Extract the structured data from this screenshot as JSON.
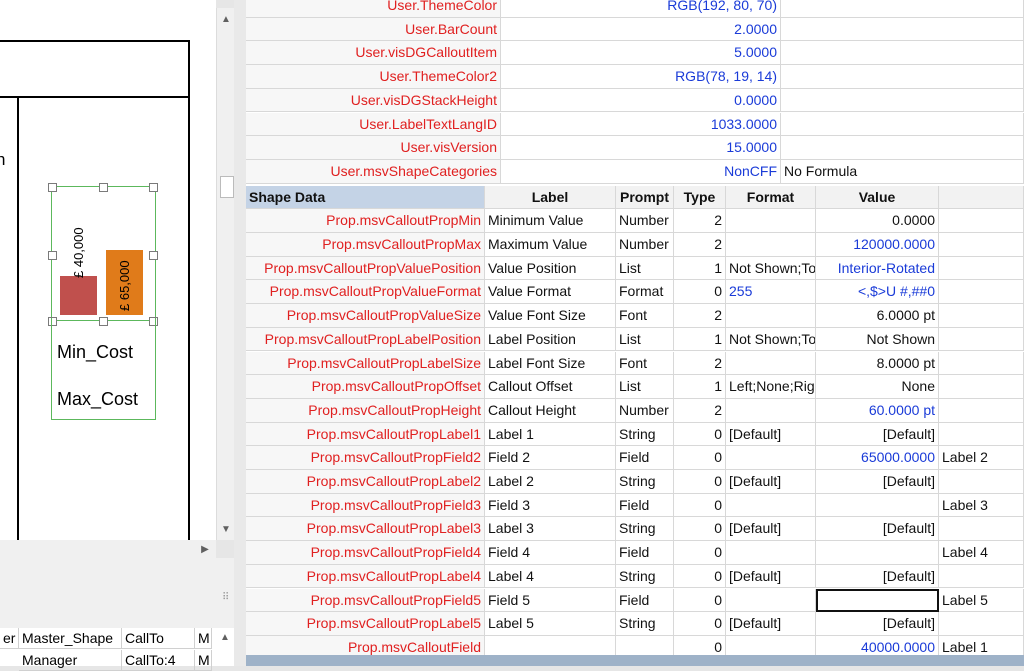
{
  "drawing": {
    "partial_letter": "n",
    "chart_labels": [
      "Min_Cost",
      "Max_Cost"
    ],
    "bars": [
      {
        "label": "£ 40,000",
        "value": 40000,
        "color": "#c0504d"
      },
      {
        "label": "£ 65,000",
        "value": 65000,
        "color": "#e07b1a"
      }
    ],
    "bar_max": 120000
  },
  "lower_grid": {
    "headers": [
      "er",
      "Master_Shape",
      "CallTo",
      "M"
    ],
    "row": [
      "",
      "Manager",
      "CallTo:4",
      "M"
    ]
  },
  "user_section": [
    {
      "name": "User.ThemeColor",
      "value": "RGB(192, 80, 70)",
      "extra": ""
    },
    {
      "name": "User.BarCount",
      "value": "2.0000",
      "extra": ""
    },
    {
      "name": "User.visDGCalloutItem",
      "value": "5.0000",
      "extra": ""
    },
    {
      "name": "User.ThemeColor2",
      "value": "RGB(78, 19, 14)",
      "extra": ""
    },
    {
      "name": "User.visDGStackHeight",
      "value": "0.0000",
      "extra": ""
    },
    {
      "name": "User.LabelTextLangID",
      "value": "1033.0000",
      "extra": ""
    },
    {
      "name": "User.visVersion",
      "value": "15.0000",
      "extra": ""
    },
    {
      "name": "User.msvShapeCategories",
      "value": "NonCFF",
      "extra": "No Formula"
    }
  ],
  "shape_data": {
    "section_title": "Shape Data",
    "columns": [
      "Label",
      "Prompt",
      "Type",
      "Format",
      "Value"
    ],
    "rows": [
      {
        "name": "Prop.msvCalloutPropMin",
        "label": "Minimum Value",
        "prompt": "Number",
        "type": "2",
        "format": "",
        "value": "0.0000",
        "value_blue": false,
        "extra": ""
      },
      {
        "name": "Prop.msvCalloutPropMax",
        "label": "Maximum Value",
        "prompt": "Number",
        "type": "2",
        "format": "",
        "value": "120000.0000",
        "value_blue": true,
        "extra": ""
      },
      {
        "name": "Prop.msvCalloutPropValuePosition",
        "label": "Value Position",
        "prompt": "List",
        "type": "1",
        "format": "Not Shown;To",
        "value": "Interior-Rotated",
        "value_blue": true,
        "extra": ""
      },
      {
        "name": "Prop.msvCalloutPropValueFormat",
        "label": "Value Format",
        "prompt": "Format",
        "type": "0",
        "format": "255",
        "value": "<,$>U #,##0",
        "value_blue": true,
        "extra": ""
      },
      {
        "name": "Prop.msvCalloutPropValueSize",
        "label": "Value Font Size",
        "prompt": "Font",
        "type": "2",
        "format": "",
        "value": "6.0000 pt",
        "value_blue": false,
        "extra": ""
      },
      {
        "name": "Prop.msvCalloutPropLabelPosition",
        "label": "Label Position",
        "prompt": "List",
        "type": "1",
        "format": "Not Shown;To",
        "value": "Not Shown",
        "value_blue": false,
        "extra": ""
      },
      {
        "name": "Prop.msvCalloutPropLabelSize",
        "label": "Label Font Size",
        "prompt": "Font",
        "type": "2",
        "format": "",
        "value": "8.0000 pt",
        "value_blue": false,
        "extra": ""
      },
      {
        "name": "Prop.msvCalloutPropOffset",
        "label": "Callout Offset",
        "prompt": "List",
        "type": "1",
        "format": "Left;None;Rig",
        "value": "None",
        "value_blue": false,
        "extra": ""
      },
      {
        "name": "Prop.msvCalloutPropHeight",
        "label": "Callout Height",
        "prompt": "Number",
        "type": "2",
        "format": "",
        "value": "60.0000 pt",
        "value_blue": true,
        "extra": ""
      },
      {
        "name": "Prop.msvCalloutPropLabel1",
        "label": "Label 1",
        "prompt": "String",
        "type": "0",
        "format": "[Default]",
        "value": "[Default]",
        "value_blue": false,
        "extra": ""
      },
      {
        "name": "Prop.msvCalloutPropField2",
        "label": "Field 2",
        "prompt": "Field",
        "type": "0",
        "format": "",
        "value": "65000.0000",
        "value_blue": true,
        "extra": "Label 2"
      },
      {
        "name": "Prop.msvCalloutPropLabel2",
        "label": "Label 2",
        "prompt": "String",
        "type": "0",
        "format": "[Default]",
        "value": "[Default]",
        "value_blue": false,
        "extra": ""
      },
      {
        "name": "Prop.msvCalloutPropField3",
        "label": "Field 3",
        "prompt": "Field",
        "type": "0",
        "format": "",
        "value": "",
        "value_blue": false,
        "extra": "Label 3"
      },
      {
        "name": "Prop.msvCalloutPropLabel3",
        "label": "Label 3",
        "prompt": "String",
        "type": "0",
        "format": "[Default]",
        "value": "[Default]",
        "value_blue": false,
        "extra": ""
      },
      {
        "name": "Prop.msvCalloutPropField4",
        "label": "Field 4",
        "prompt": "Field",
        "type": "0",
        "format": "",
        "value": "",
        "value_blue": false,
        "extra": "Label 4"
      },
      {
        "name": "Prop.msvCalloutPropLabel4",
        "label": "Label 4",
        "prompt": "String",
        "type": "0",
        "format": "[Default]",
        "value": "[Default]",
        "value_blue": false,
        "extra": ""
      },
      {
        "name": "Prop.msvCalloutPropField5",
        "label": "Field 5",
        "prompt": "Field",
        "type": "0",
        "format": "",
        "value": "",
        "value_blue": false,
        "extra": "Label 5",
        "selected": true
      },
      {
        "name": "Prop.msvCalloutPropLabel5",
        "label": "Label 5",
        "prompt": "String",
        "type": "0",
        "format": "[Default]",
        "value": "[Default]",
        "value_blue": false,
        "extra": ""
      },
      {
        "name": "Prop.msvCalloutField",
        "label": "",
        "prompt": "",
        "type": "0",
        "format": "",
        "value": "40000.0000",
        "value_blue": true,
        "extra": "Label 1"
      }
    ]
  },
  "colors": {
    "cell_name": "#e02020",
    "formula_value": "#1a3bd8",
    "section_header": "#c4d3e6",
    "selection_outline": "#5cb85c"
  }
}
